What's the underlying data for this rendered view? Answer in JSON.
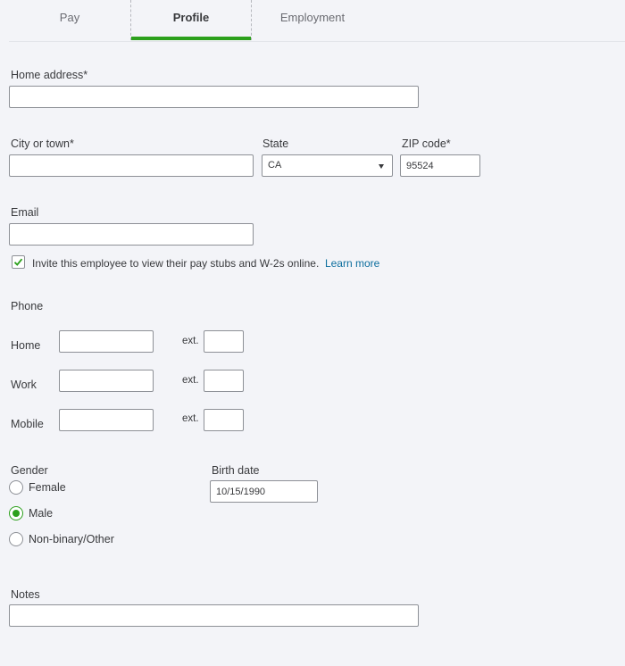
{
  "tabs": [
    {
      "label": "Pay",
      "active": false
    },
    {
      "label": "Profile",
      "active": true
    },
    {
      "label": "Employment",
      "active": false
    }
  ],
  "address": {
    "home_address_label": "Home address*",
    "home_address_value": "",
    "city_label": "City or town*",
    "city_value": "",
    "state_label": "State",
    "state_value": "CA",
    "zip_label": "ZIP code*",
    "zip_value": "95524"
  },
  "email": {
    "label": "Email",
    "value": "",
    "invite_text": "Invite this employee to view their pay stubs and W-2s online.",
    "invite_checked": true,
    "learn_more": "Learn more"
  },
  "phone": {
    "label": "Phone",
    "ext_label": "ext.",
    "rows": [
      {
        "label": "Home",
        "value": "",
        "ext": ""
      },
      {
        "label": "Work",
        "value": "",
        "ext": ""
      },
      {
        "label": "Mobile",
        "value": "",
        "ext": ""
      }
    ]
  },
  "gender": {
    "label": "Gender",
    "options": [
      "Female",
      "Male",
      "Non-binary/Other"
    ],
    "selected": "Male"
  },
  "birth_date": {
    "label": "Birth date",
    "value": "10/15/1990"
  },
  "notes": {
    "label": "Notes",
    "value": ""
  },
  "colors": {
    "accent": "#2ca01c",
    "link": "#0d6e9e",
    "background": "#f3f4f8"
  }
}
